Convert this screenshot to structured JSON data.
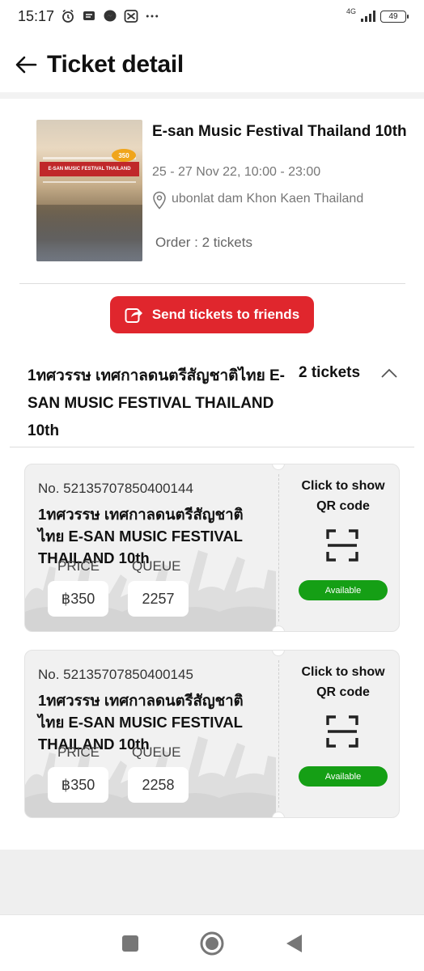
{
  "status_bar": {
    "time": "15:17",
    "network": "4G",
    "battery": "49",
    "icons": [
      "alarm-icon",
      "message-icon",
      "messenger-icon",
      "capcut-icon",
      "more-dots-icon",
      "signal-icon",
      "battery-icon"
    ]
  },
  "header": {
    "title": "Ticket detail",
    "back_icon": "arrow-left-icon"
  },
  "event": {
    "name": "E-san Music Festival Thailand 10th",
    "date": "25 - 27 Nov 22, 10:00 - 23:00",
    "location": "ubonlat dam Khon Kaen Thailand",
    "order": "Order : 2 tickets",
    "poster_banner_text": "E-SAN MUSIC FESTIVAL THAILAND",
    "poster_badge_text": "350"
  },
  "send_button": {
    "label": "Send tickets to friends",
    "icon": "share-icon"
  },
  "ticket_group": {
    "title": "1ทศวรรษ เทศกาลดนตรีสัญชาติไทย E-SAN MUSIC FESTIVAL THAILAND 10th",
    "count": "2 tickets",
    "expanded": true
  },
  "tickets": [
    {
      "number": "No. 52135707850400144",
      "name": "1ทศวรรษ เทศกาลดนตรีสัญชาติไทย E-SAN MUSIC FESTIVAL THAILAND 10th",
      "price_label": "PRICE",
      "price": "฿350",
      "queue_label": "QUEUE",
      "queue": "2257",
      "qr_label": "Click to show QR code",
      "status": "Available"
    },
    {
      "number": "No. 52135707850400145",
      "name": "1ทศวรรษ เทศกาลดนตรีสัญชาติไทย E-SAN MUSIC FESTIVAL THAILAND 10th",
      "price_label": "PRICE",
      "price": "฿350",
      "queue_label": "QUEUE",
      "queue": "2258",
      "qr_label": "Click to show QR code",
      "status": "Available"
    }
  ],
  "colors": {
    "accent_red": "#e0262d",
    "available_green": "#159f15",
    "ticket_bg": "#f1f1f1"
  },
  "nav_bar": {
    "items": [
      "recent-apps-icon",
      "home-icon",
      "back-triangle-icon"
    ]
  }
}
